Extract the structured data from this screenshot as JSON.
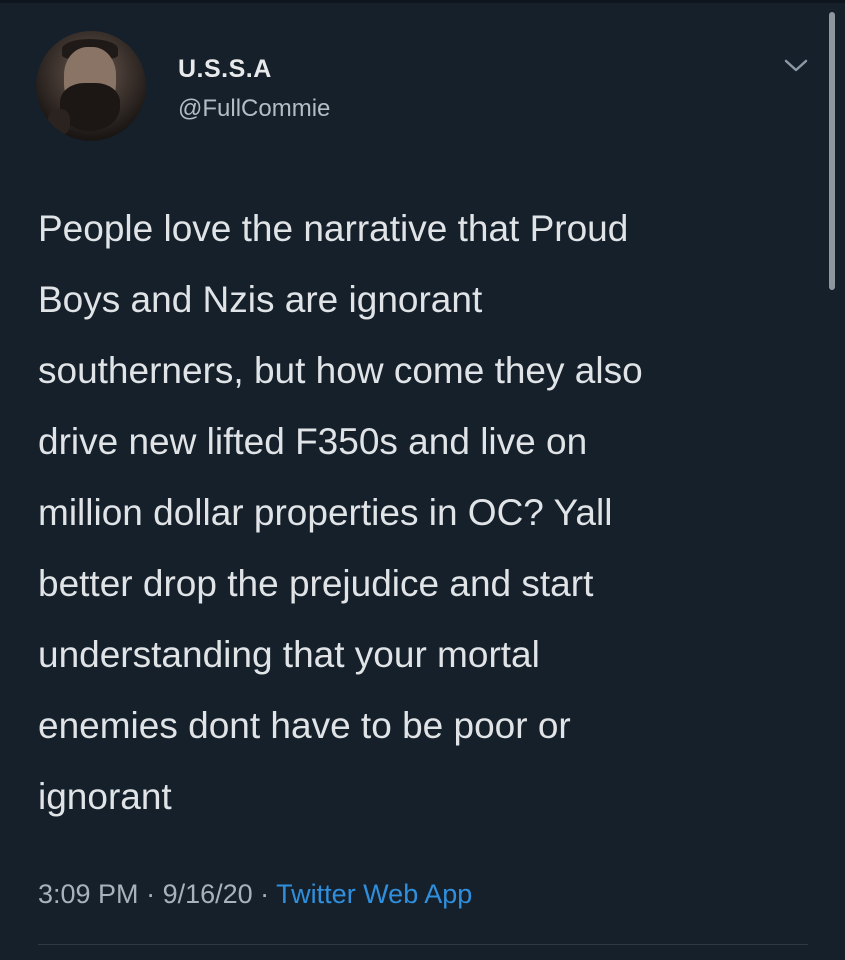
{
  "tweet": {
    "author": {
      "display_name": "U.S.S.A",
      "handle": "@FullCommie",
      "avatar_icon": "profile-photo"
    },
    "menu_icon": "chevron-down-icon",
    "text": "People love the narrative that Proud\nBoys and Nzis are ignorant\nsoutherners, but how come they also\ndrive new lifted F350s and live on\nmillion dollar properties in OC? Yall\nbetter drop the prejudice and start\nunderstanding that your mortal\nenemies dont have to be poor or\nignorant",
    "meta": {
      "time": "3:09 PM",
      "separator": " · ",
      "date": "9/16/20",
      "source": "Twitter Web App"
    }
  },
  "colors": {
    "background": "#15202b",
    "accent": "#2f8fdd",
    "text": "#e1e4e7",
    "secondary_text": "#a9b2ba"
  }
}
